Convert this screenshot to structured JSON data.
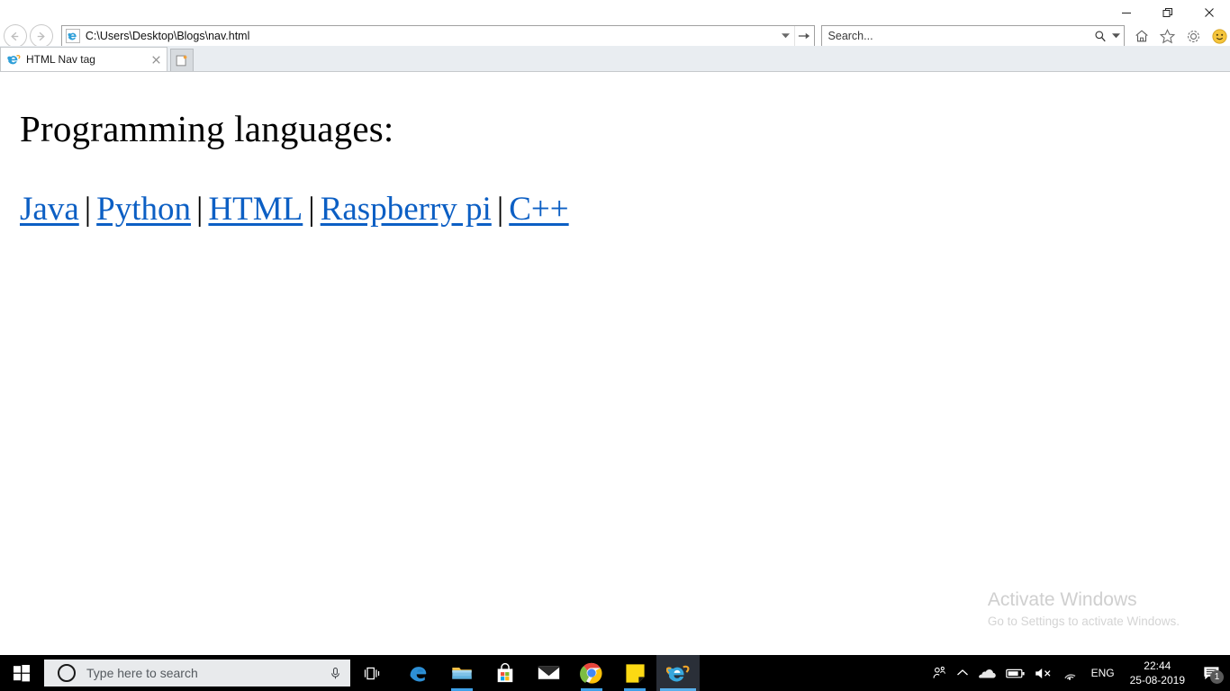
{
  "window": {
    "minimize_label": "Minimize",
    "restore_label": "Restore",
    "close_label": "Close"
  },
  "toolbar": {
    "back_label": "Back",
    "forward_label": "Forward",
    "address_value": "C:\\Users\\Desktop\\Blogs\\nav.html",
    "address_dropdown_label": "Address history",
    "go_label": "Go",
    "search_placeholder": "Search...",
    "search_dropdown_label": "Search options",
    "icons": [
      {
        "name": "home-icon",
        "label": "Home"
      },
      {
        "name": "favorites-star-icon",
        "label": "View favorites, feeds and history"
      },
      {
        "name": "gear-icon",
        "label": "Tools"
      },
      {
        "name": "smiley-feedback-icon",
        "label": "Send a smile feedback"
      }
    ]
  },
  "tabs": {
    "items": [
      {
        "title": "HTML Nav tag",
        "close_label": "Close tab"
      }
    ],
    "new_tab_label": "New tab"
  },
  "page": {
    "heading": "Programming languages:",
    "separator": "|",
    "links": [
      {
        "label": "Java"
      },
      {
        "label": "Python"
      },
      {
        "label": "HTML"
      },
      {
        "label": "Raspberry pi"
      },
      {
        "label": "C++"
      }
    ],
    "link_color": "#0c5fc4",
    "watermark_title": "Activate Windows",
    "watermark_subtitle": "Go to Settings to activate Windows."
  },
  "taskbar": {
    "start_label": "Start",
    "search_placeholder": "Type here to search",
    "mic_label": "Search with microphone",
    "taskview_label": "Task View",
    "apps": [
      {
        "name": "edge",
        "label": "Microsoft Edge",
        "running": false,
        "active": false
      },
      {
        "name": "file-explorer",
        "label": "File Explorer",
        "running": true,
        "active": false
      },
      {
        "name": "microsoft-store",
        "label": "Microsoft Store",
        "running": false,
        "active": false
      },
      {
        "name": "mail",
        "label": "Mail",
        "running": false,
        "active": false
      },
      {
        "name": "chrome",
        "label": "Google Chrome",
        "running": true,
        "active": false
      },
      {
        "name": "sticky-notes",
        "label": "Sticky Notes",
        "running": true,
        "active": false
      },
      {
        "name": "internet-explorer",
        "label": "Internet Explorer",
        "running": true,
        "active": true
      }
    ],
    "tray": {
      "people_label": "People",
      "show_hidden_label": "Show hidden icons",
      "onedrive_label": "OneDrive",
      "battery_label": "Battery",
      "volume_label": "Volume muted",
      "network_label": "Network",
      "language": "ENG",
      "time": "22:44",
      "date": "25-08-2019",
      "action_center_label": "Action Center",
      "notification_count": "1"
    }
  }
}
